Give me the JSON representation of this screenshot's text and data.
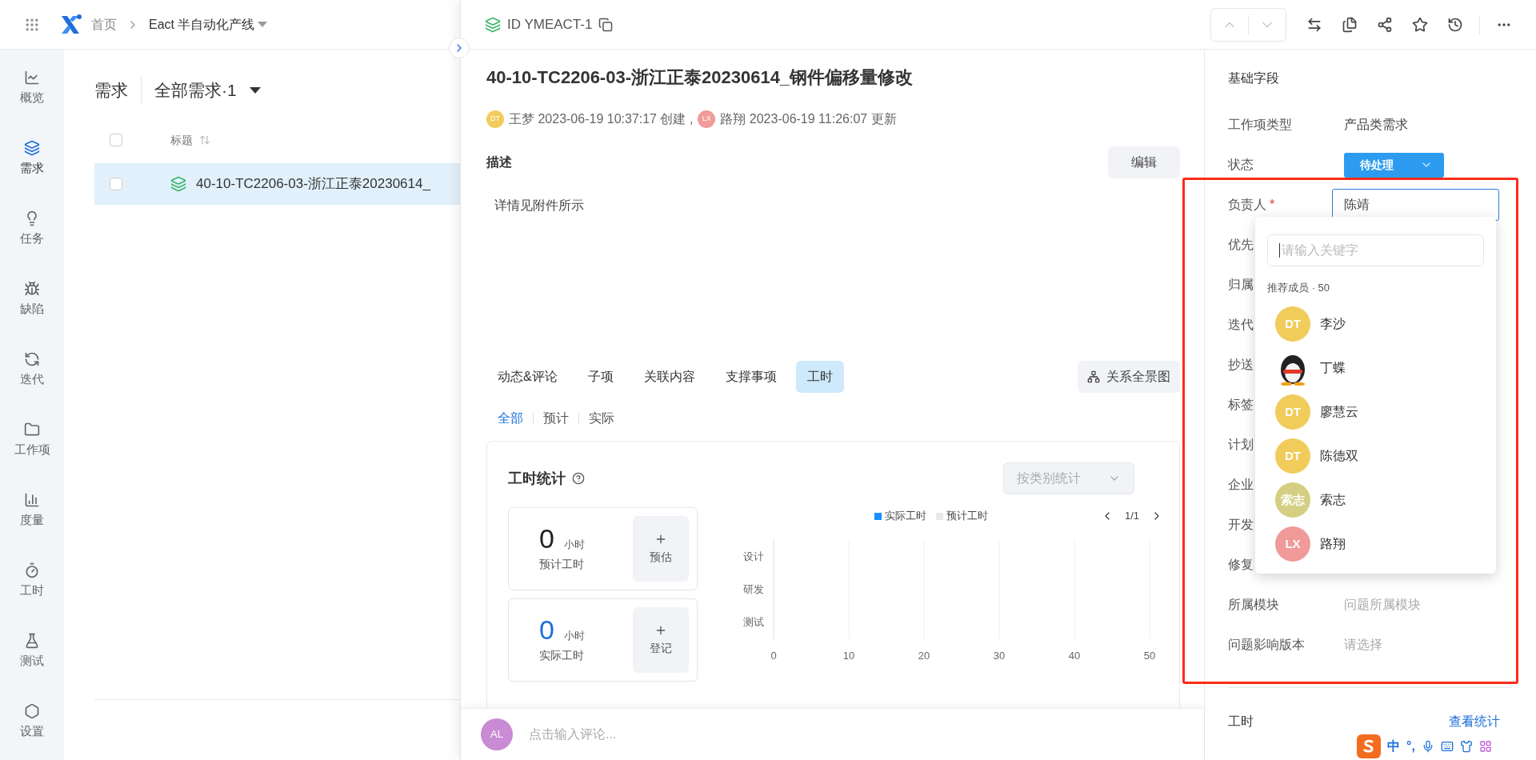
{
  "topbar": {
    "breadcrumb": [
      "首页",
      "Eact 半自动化产线"
    ]
  },
  "sidebar": {
    "items": [
      {
        "label": "概览",
        "selected": false
      },
      {
        "label": "需求",
        "selected": true
      },
      {
        "label": "任务",
        "selected": false
      },
      {
        "label": "缺陷",
        "selected": false
      },
      {
        "label": "迭代",
        "selected": false
      },
      {
        "label": "工作项",
        "selected": false
      },
      {
        "label": "度量",
        "selected": false
      },
      {
        "label": "工时",
        "selected": false
      },
      {
        "label": "测试",
        "selected": false
      },
      {
        "label": "设置",
        "selected": false
      }
    ]
  },
  "list": {
    "title": "需求",
    "view": "全部需求·1",
    "select_all_checked": false,
    "columns": [
      "标题"
    ],
    "rows": [
      {
        "title": "40-10-TC2206-03-浙江正泰20230614_",
        "selected": true,
        "checked": false
      }
    ]
  },
  "detail": {
    "id": "ID YMEACT-1",
    "title": "40-10-TC2206-03-浙江正泰20230614_钢件偏移量修改",
    "meta": [
      {
        "initials": "DT",
        "color": "#f2cc5a",
        "text": "王梦 2023-06-19 10:37:17 创建 ,"
      },
      {
        "initials": "LX",
        "color": "#f09a9a",
        "text": "路翔 2023-06-19 11:26:07 更新"
      }
    ],
    "description_label": "描述",
    "edit_button": "编辑",
    "description": "详情见附件所示",
    "tabs": [
      {
        "label": "动态&评论",
        "selected": false
      },
      {
        "label": "子项",
        "selected": false
      },
      {
        "label": "关联内容",
        "selected": false
      },
      {
        "label": "支撑事项",
        "selected": false
      },
      {
        "label": "工时",
        "selected": true
      }
    ],
    "relation_button": "关系全景图",
    "subtabs": [
      {
        "label": "全部",
        "selected": true
      },
      {
        "label": "预计",
        "selected": false
      },
      {
        "label": "实际",
        "selected": false
      }
    ],
    "worktime": {
      "title": "工时统计",
      "group_select": "按类别统计",
      "stats": [
        {
          "value": "0",
          "unit": "小时",
          "label": "预计工时",
          "action": "预估",
          "kind": "estimate"
        },
        {
          "value": "0",
          "unit": "小时",
          "label": "实际工时",
          "action": "登记",
          "kind": "actual"
        }
      ],
      "pager": "1/1",
      "chart_data": {
        "type": "bar",
        "orientation": "horizontal",
        "categories": [
          "设计",
          "研发",
          "测试"
        ],
        "series": [
          {
            "name": "实际工时",
            "color": "#1890ff",
            "values": [
              0,
              0,
              0
            ]
          },
          {
            "name": "预计工时",
            "color": "#e8e8e8",
            "values": [
              0,
              0,
              0
            ]
          }
        ],
        "xlim": [
          0,
          50
        ],
        "xticks": [
          0,
          10,
          20,
          30,
          40,
          50
        ],
        "grid": true
      }
    },
    "comment": {
      "initials": "AL",
      "color": "#c98bd3",
      "placeholder": "点击输入评论..."
    }
  },
  "fields": {
    "title": "基础字段",
    "rows": [
      {
        "label": "工作项类型",
        "value": "产品类需求",
        "kind": "text"
      },
      {
        "label": "状态",
        "value": "待处理",
        "kind": "status"
      },
      {
        "label": "负责人",
        "value": "陈靖",
        "kind": "input",
        "required_mark": "*"
      },
      {
        "label": "优先",
        "kind": "hidden"
      },
      {
        "label": "归属",
        "kind": "hidden"
      },
      {
        "label": "迭代",
        "kind": "hidden"
      },
      {
        "label": "抄送",
        "kind": "hidden"
      },
      {
        "label": "标签",
        "kind": "hidden"
      },
      {
        "label": "计划",
        "kind": "hidden"
      },
      {
        "label": "企业",
        "kind": "hidden"
      },
      {
        "label": "开发",
        "kind": "hidden"
      },
      {
        "label": "修复",
        "kind": "hidden"
      },
      {
        "label": "所属模块",
        "placeholder": "问题所属模块",
        "kind": "placeholder"
      },
      {
        "label": "问题影响版本",
        "placeholder": "请选择",
        "kind": "placeholder"
      }
    ],
    "worktime_label": "工时",
    "worktime_link": "查看统计"
  },
  "member_dropdown": {
    "placeholder": "请输入关键字",
    "heading": "推荐成员 · 50",
    "members": [
      {
        "name": "李沙",
        "kind": "initials",
        "initials": "DT",
        "color": "#f2cc5a"
      },
      {
        "name": "丁蝶",
        "kind": "image"
      },
      {
        "name": "廖慧云",
        "kind": "initials",
        "initials": "DT",
        "color": "#f2cc5a"
      },
      {
        "name": "陈德双",
        "kind": "initials",
        "initials": "DT",
        "color": "#f2cc5a"
      },
      {
        "name": "索志",
        "kind": "initials",
        "initials": "索志",
        "color": "#d4cf82"
      },
      {
        "name": "路翔",
        "kind": "initials",
        "initials": "LX",
        "color": "#f09a9a"
      }
    ]
  },
  "ime_bar": {
    "items": [
      "中",
      "°,"
    ]
  }
}
